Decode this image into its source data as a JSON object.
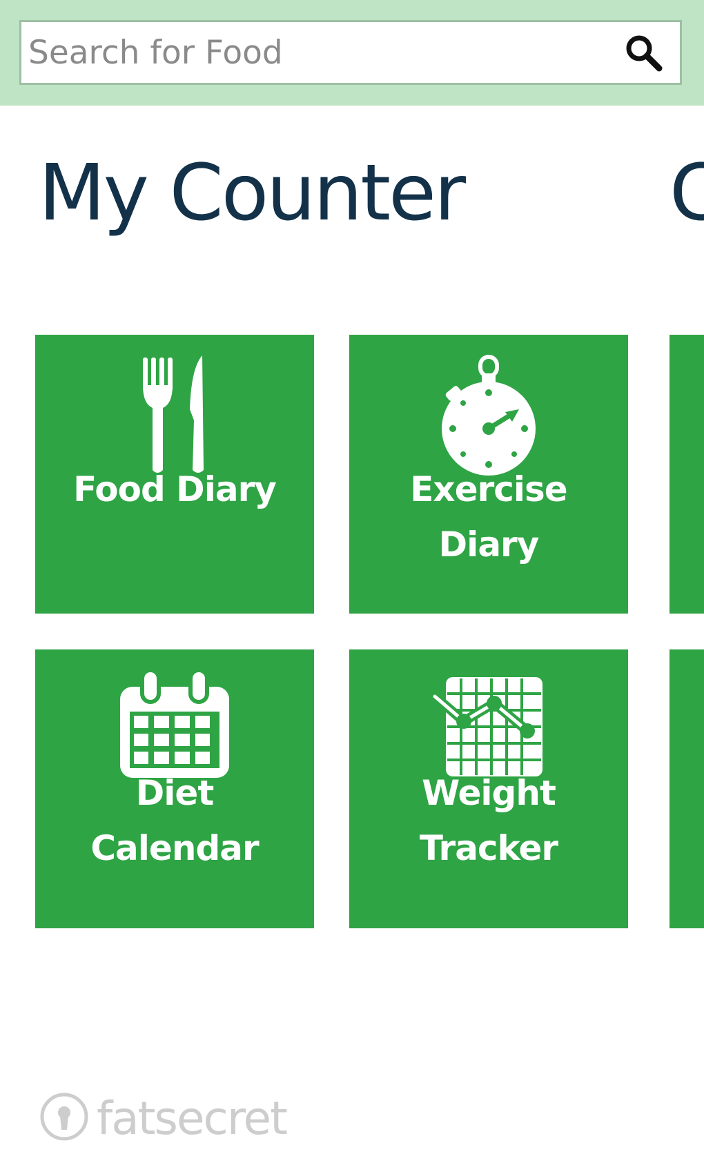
{
  "search": {
    "placeholder": "Search for Food",
    "value": "",
    "icon": "search-icon"
  },
  "header": {
    "title": "My Counter",
    "next_panorama_title": "C"
  },
  "tiles": [
    {
      "label": "Food Diary",
      "icon": "fork-knife-icon"
    },
    {
      "label": "Exercise Diary",
      "icon": "stopwatch-icon"
    },
    {
      "label": "Diet Calendar",
      "icon": "calendar-icon"
    },
    {
      "label": "Weight Tracker",
      "icon": "weight-chart-icon"
    }
  ],
  "brand": {
    "name": "fatsecret",
    "icon": "fatsecret-logo-icon"
  },
  "colors": {
    "tile_green": "#2ea444",
    "search_band": "#bfe3c5",
    "title_text": "#13324a",
    "brand_text": "#cdcdcd"
  }
}
